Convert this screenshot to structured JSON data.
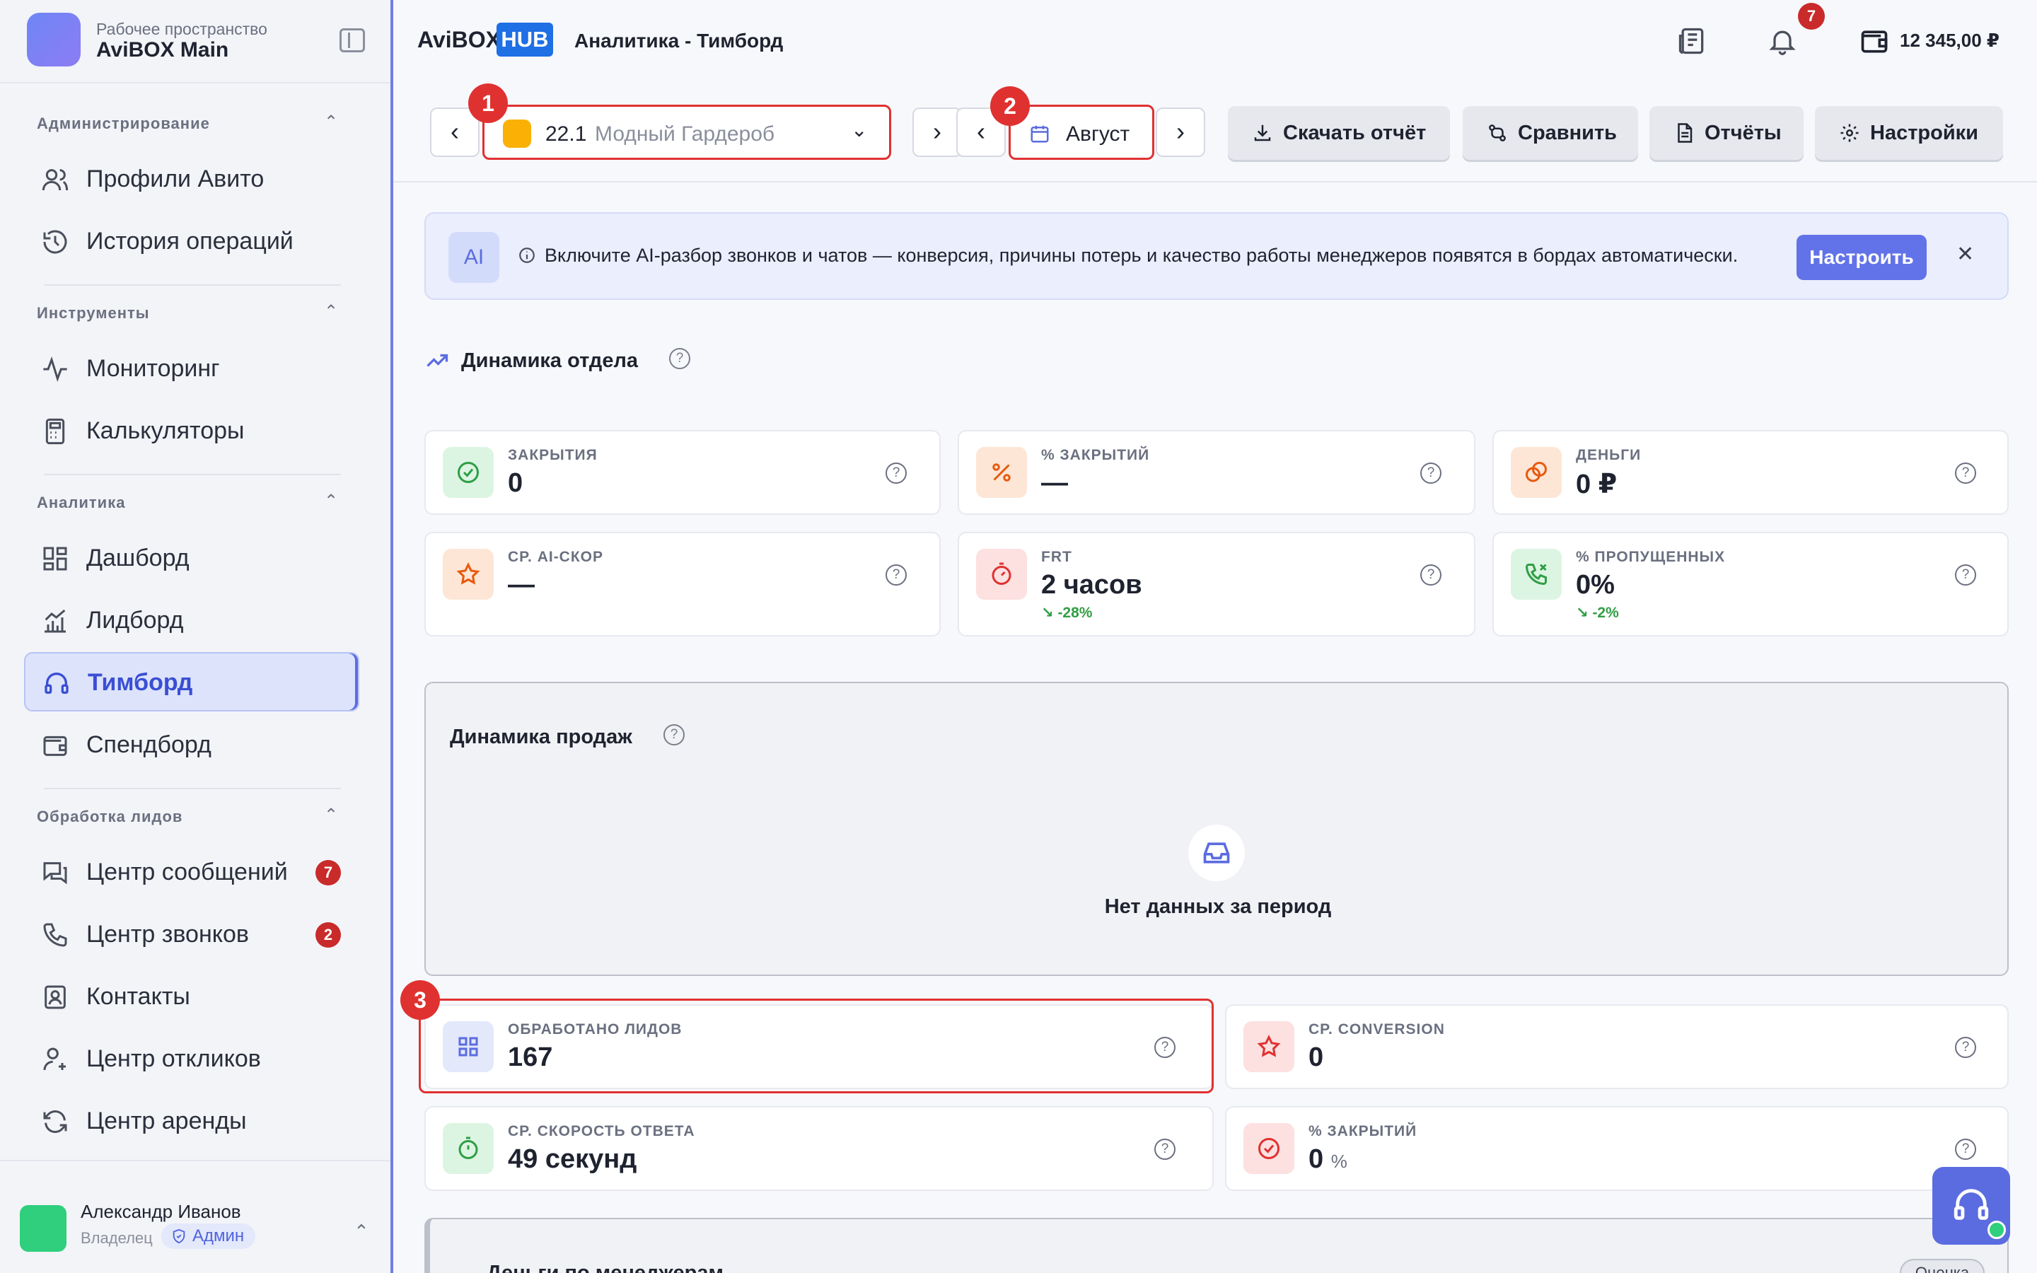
{
  "workspace": {
    "subtitle": "Рабочее пространство",
    "name": "AviBOX Main"
  },
  "sidebar": {
    "sections": [
      {
        "title": "Администрирование"
      },
      {
        "title": "Инструменты"
      },
      {
        "title": "Аналитика"
      },
      {
        "title": "Обработка лидов"
      }
    ],
    "items": [
      {
        "label": "Профили Авито",
        "icon": "users-icon"
      },
      {
        "label": "История операций",
        "icon": "history-icon"
      },
      {
        "label": "Мониторинг",
        "icon": "activity-icon"
      },
      {
        "label": "Калькуляторы",
        "icon": "calculator-icon"
      },
      {
        "label": "Дашборд",
        "icon": "dashboard-icon"
      },
      {
        "label": "Лидборд",
        "icon": "chart-icon"
      },
      {
        "label": "Тимборд",
        "icon": "headset-icon",
        "active": true
      },
      {
        "label": "Спендборд",
        "icon": "wallet-icon"
      },
      {
        "label": "Центр сообщений",
        "icon": "messages-icon",
        "badge": "7"
      },
      {
        "label": "Центр звонков",
        "icon": "phone-icon",
        "badge": "2"
      },
      {
        "label": "Контакты",
        "icon": "contacts-icon"
      },
      {
        "label": "Центр откликов",
        "icon": "user-response-icon"
      },
      {
        "label": "Центр аренды",
        "icon": "refresh-icon"
      }
    ]
  },
  "user": {
    "name": "Александр Иванов",
    "role": "Владелец",
    "badge": "Админ"
  },
  "header": {
    "brand_main": "AviBOX",
    "brand_hub": "HUB",
    "title": "Аналитика - Тимборд",
    "notifications": "7",
    "balance": "12 345,00 ₽"
  },
  "toolbar": {
    "shop_number": "22.1",
    "shop_name": "Модный Гардероб",
    "period": "Август",
    "download": "Скачать отчёт",
    "compare": "Сравнить",
    "reports": "Отчёты",
    "settings": "Настройки",
    "markers": [
      "1",
      "2",
      "3"
    ]
  },
  "banner": {
    "ai_label": "AI",
    "text": "Включите AI-разбор звонков и чатов — конверсия, причины потерь и качество работы менеджеров появятся в бордах автоматически.",
    "button": "Настроить"
  },
  "dept": {
    "title": "Динамика отдела",
    "cards": [
      {
        "label": "ЗАКРЫТИЯ",
        "value": "0"
      },
      {
        "label": "% ЗАКРЫТИЙ",
        "value": "—"
      },
      {
        "label": "ДЕНЬГИ",
        "value": "0 ₽"
      },
      {
        "label": "СР. AI-СКОР",
        "value": "—"
      },
      {
        "label": "FRT",
        "value": "2 часов",
        "delta": "-28%"
      },
      {
        "label": "% ПРОПУЩЕННЫХ",
        "value": "0%",
        "delta": "-2%"
      }
    ]
  },
  "sales": {
    "title": "Динамика продаж",
    "empty": "Нет данных за период"
  },
  "metrics": [
    {
      "label": "ОБРАБОТАНО ЛИДОВ",
      "value": "167"
    },
    {
      "label": "СР. CONVERSION",
      "value": "0"
    },
    {
      "label": "СР. СКОРОСТЬ ОТВЕТА",
      "value": "49 секунд"
    },
    {
      "label": "% ЗАКРЫТИЙ",
      "value": "0",
      "unit": "%"
    }
  ],
  "managers": {
    "title": "Деньги по менеджерам",
    "chip": "Оценка"
  },
  "colors": {
    "accent": "#5b6ce0",
    "highlight": "#e03131",
    "badge": "#c92a2a",
    "hub": "#1f6fe5",
    "positive": "#2f9e44"
  }
}
